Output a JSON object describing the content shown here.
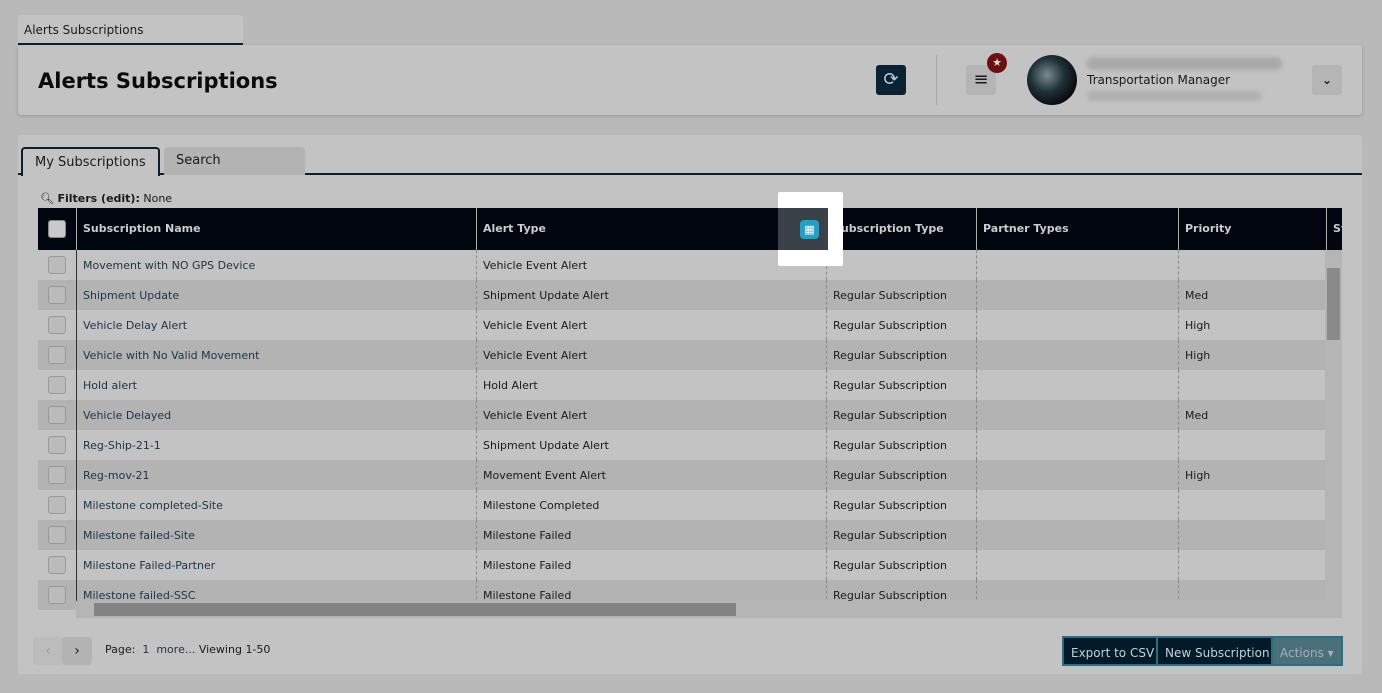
{
  "page_tab": "Alerts Subscriptions",
  "header": {
    "title": "Alerts Subscriptions",
    "role": "Transportation Manager"
  },
  "tabs": [
    "My Subscriptions",
    "Search"
  ],
  "filters": {
    "label": "Filters (edit):",
    "value": "None"
  },
  "columns": [
    "Subscription Name",
    "Alert Type",
    "Subscription Type",
    "Partner Types",
    "Priority",
    "Sy"
  ],
  "rows": [
    [
      "Movement with NO GPS Device",
      "Vehicle Event Alert",
      "",
      "",
      ""
    ],
    [
      "Shipment Update",
      "Shipment Update Alert",
      "Regular Subscription",
      "",
      "Med"
    ],
    [
      "Vehicle Delay Alert",
      "Vehicle Event Alert",
      "Regular Subscription",
      "",
      "High"
    ],
    [
      "Vehicle with No Valid Movement",
      "Vehicle Event Alert",
      "Regular Subscription",
      "",
      "High"
    ],
    [
      "Hold alert",
      "Hold Alert",
      "Regular Subscription",
      "",
      ""
    ],
    [
      "Vehicle Delayed",
      "Vehicle Event Alert",
      "Regular Subscription",
      "",
      "Med"
    ],
    [
      "Reg-Ship-21-1",
      "Shipment Update Alert",
      "Regular Subscription",
      "",
      ""
    ],
    [
      "Reg-mov-21",
      "Movement Event Alert",
      "Regular Subscription",
      "",
      "High"
    ],
    [
      "Milestone completed-Site",
      "Milestone Completed",
      "Regular Subscription",
      "",
      ""
    ],
    [
      "Milestone failed-Site",
      "Milestone Failed",
      "Regular Subscription",
      "",
      ""
    ],
    [
      "Milestone Failed-Partner",
      "Milestone Failed",
      "Regular Subscription",
      "",
      ""
    ],
    [
      "Milestone failed-SSC",
      "Milestone Failed",
      "Regular Subscription",
      "",
      ""
    ]
  ],
  "pager": {
    "page_label": "Page:",
    "page": "1",
    "more": "more...",
    "viewing": "Viewing 1-50"
  },
  "buttons": {
    "export": "Export to CSV",
    "new": "New Subscription",
    "actions": "Actions"
  }
}
